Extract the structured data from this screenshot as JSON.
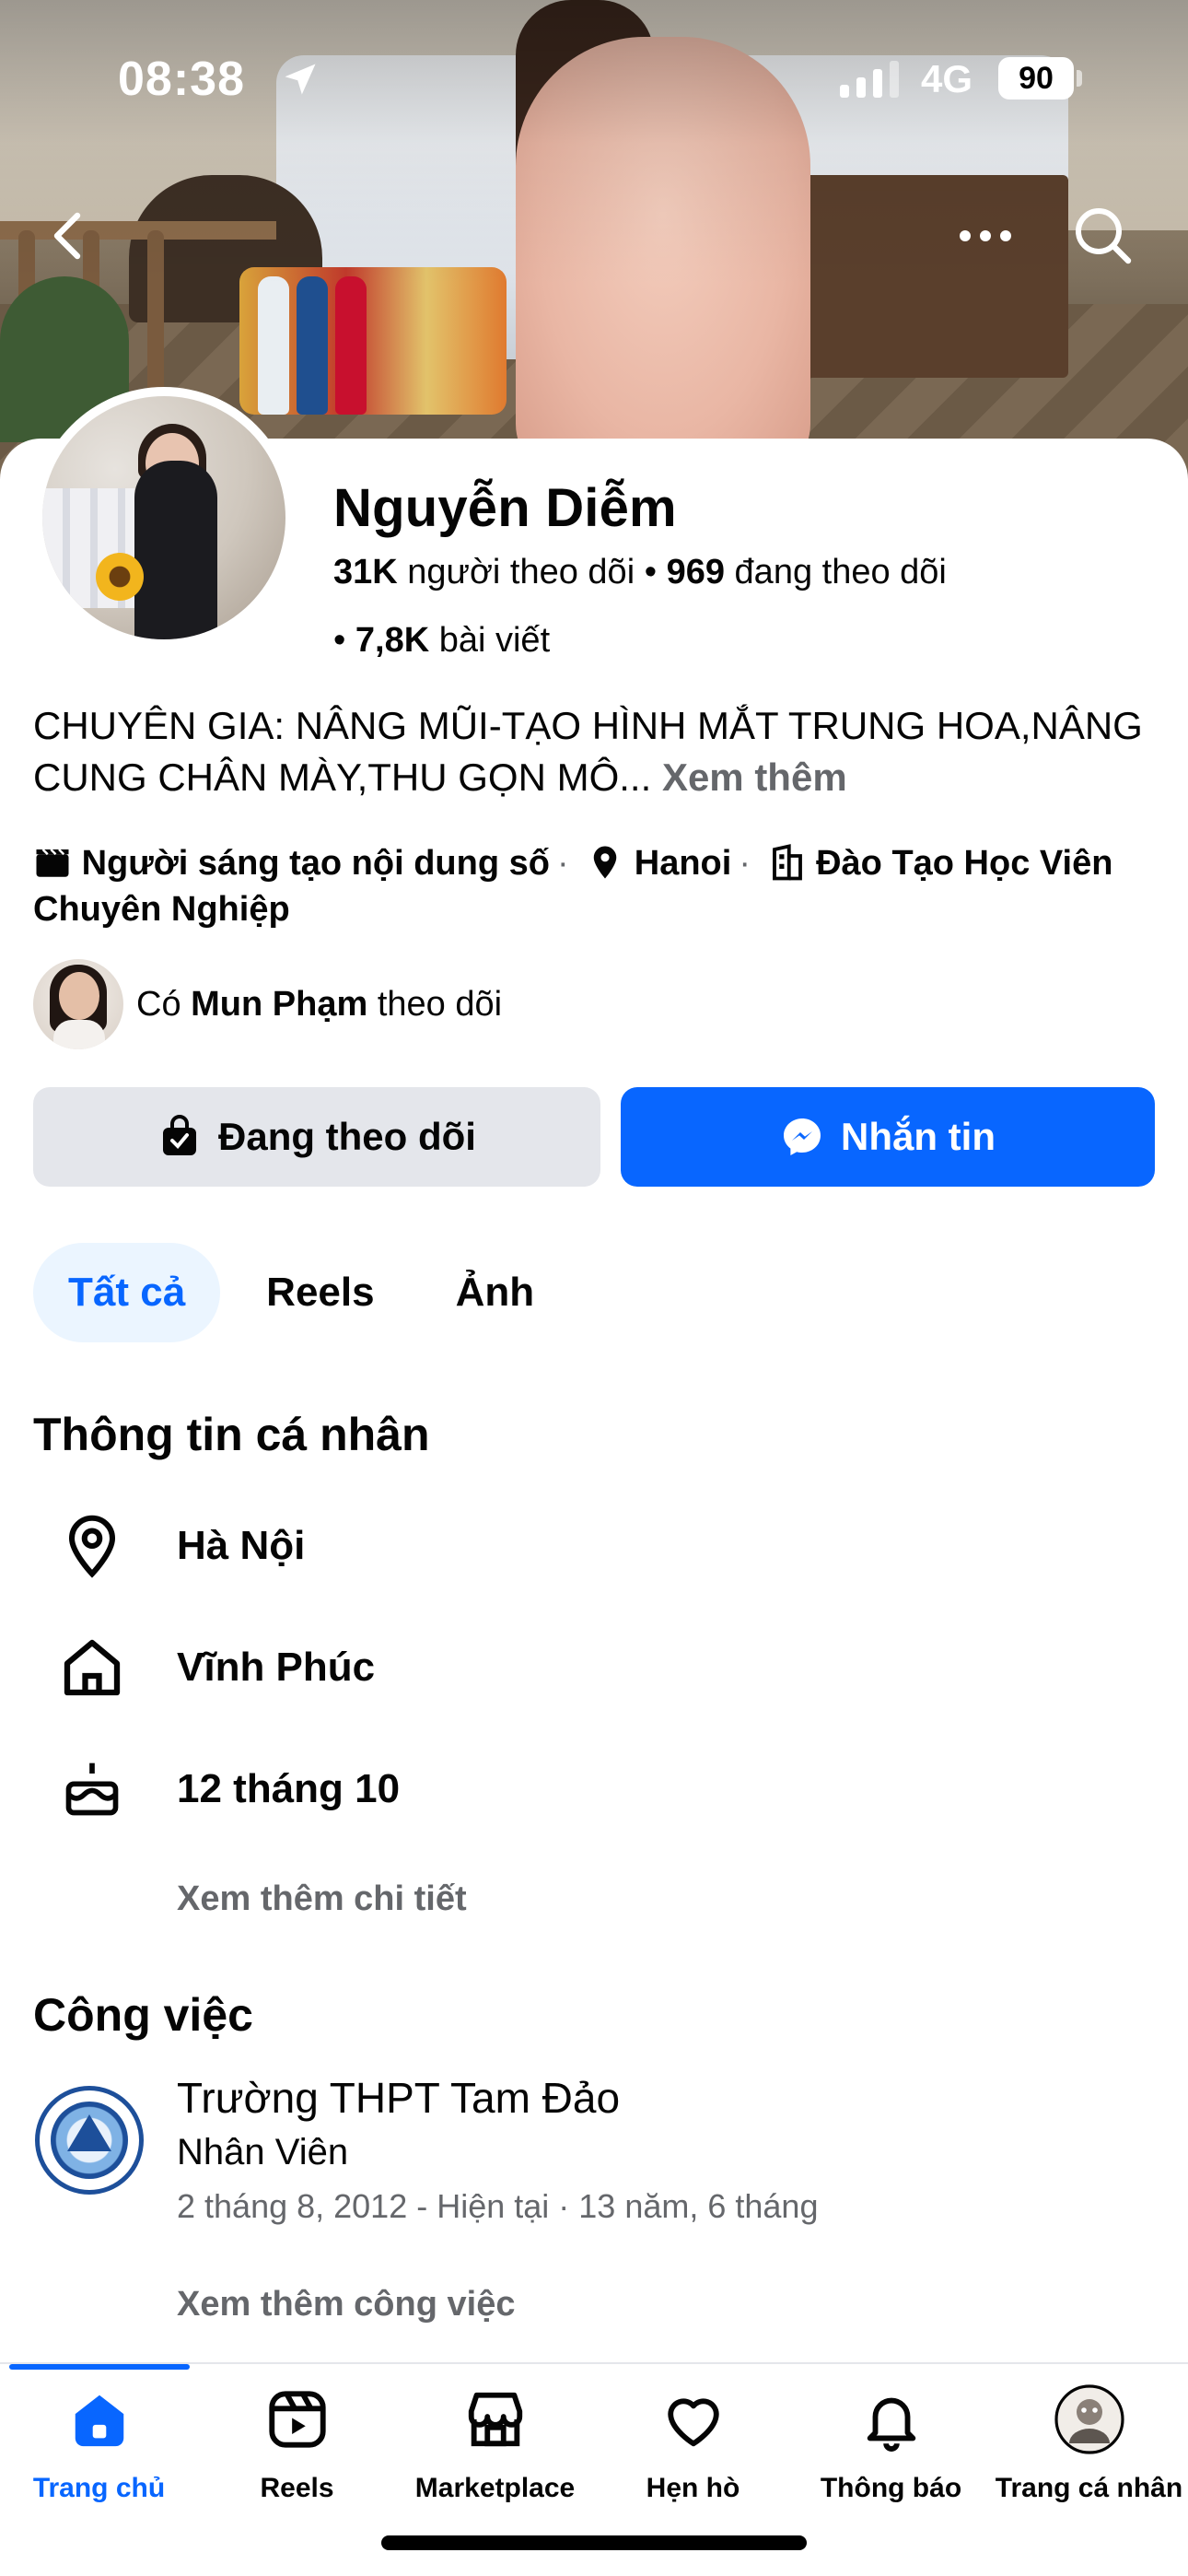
{
  "status_bar": {
    "time": "08:38",
    "network": "4G",
    "battery": "90"
  },
  "profile": {
    "name": "Nguyễn Diễm",
    "followers_count": "31K",
    "followers_label": "người theo dõi",
    "following_count": "969",
    "following_label": "đang theo dõi",
    "posts_count": "7,8K",
    "posts_label": "bài viết",
    "bio": "CHUYÊN GIA: NÂNG MŨI-TẠO HÌNH MẮT TRUNG HOA,NÂNG CUNG CHÂN MÀY,THU GỌN MÔ...",
    "bio_more": "Xem thêm",
    "category": "Người sáng tạo nội dung số",
    "location": "Hanoi",
    "work_short": "Đào Tạo Học Viên Chuyên Nghiệp",
    "mutual_prefix": "Có",
    "mutual_name": "Mun Phạm",
    "mutual_suffix": "theo dõi"
  },
  "actions": {
    "following_label": "Đang theo dõi",
    "message_label": "Nhắn tin"
  },
  "tabs": [
    {
      "label": "Tất cả",
      "active": true
    },
    {
      "label": "Reels",
      "active": false
    },
    {
      "label": "Ảnh",
      "active": false
    }
  ],
  "personal_info": {
    "title": "Thông tin cá nhân",
    "items": [
      {
        "icon": "location-pin-icon",
        "text": "Hà Nội"
      },
      {
        "icon": "home-icon",
        "text": "Vĩnh Phúc"
      },
      {
        "icon": "birthday-cake-icon",
        "text": "12 tháng 10"
      }
    ],
    "see_more": "Xem thêm chi tiết"
  },
  "work": {
    "title": "Công việc",
    "employer": "Trường THPT Tam Đảo",
    "position": "Nhân Viên",
    "period": "2 tháng 8, 2012 - Hiện tại · 13 năm, 6 tháng",
    "see_more": "Xem thêm công việc"
  },
  "bottom_nav": [
    {
      "label": "Trang chủ",
      "icon": "home-icon",
      "active": true
    },
    {
      "label": "Reels",
      "icon": "reels-icon",
      "active": false
    },
    {
      "label": "Marketplace",
      "icon": "marketplace-icon",
      "active": false
    },
    {
      "label": "Hẹn hò",
      "icon": "dating-heart-icon",
      "active": false
    },
    {
      "label": "Thông báo",
      "icon": "bell-icon",
      "active": false
    },
    {
      "label": "Trang cá nhân",
      "icon": "profile-avatar-icon",
      "active": false
    }
  ],
  "colors": {
    "accent": "#0866ff",
    "secondary_text": "#65676b",
    "button_gray": "#e4e6eb"
  }
}
